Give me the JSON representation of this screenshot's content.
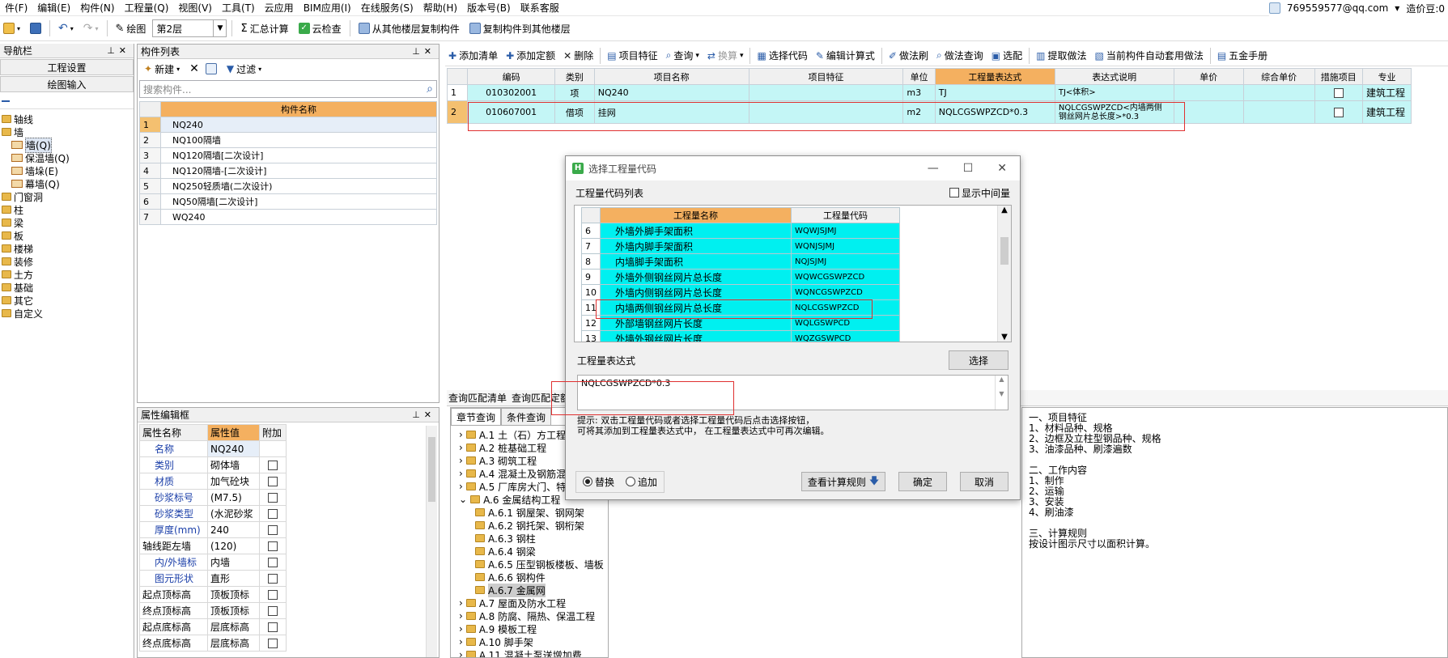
{
  "menubar": {
    "items": [
      "件(F)",
      "编辑(E)",
      "构件(N)",
      "工程量(Q)",
      "视图(V)",
      "工具(T)",
      "云应用",
      "BIM应用(I)",
      "在线服务(S)",
      "帮助(H)",
      "版本号(B)",
      "联系客服"
    ],
    "account": "769559577@qq.com",
    "account_suffix": "▾",
    "coins": "造价豆:0"
  },
  "toolbar1": {
    "draw_label": "绘图",
    "floor": "第2层",
    "sum_calc": "汇总计算",
    "cloud_check": "云检查",
    "copy_from_floor": "从其他楼层复制构件",
    "copy_to_floor": "复制构件到其他楼层"
  },
  "nav": {
    "title": "导航栏",
    "btn1": "工程设置",
    "btn2": "绘图输入",
    "tree": [
      {
        "label": "轴线",
        "indent": 0,
        "type": "folder"
      },
      {
        "label": "墙",
        "indent": 0,
        "type": "folder"
      },
      {
        "label": "墙(Q)",
        "indent": 1,
        "type": "wall"
      },
      {
        "label": "保温墙(Q)",
        "indent": 1,
        "type": "wall"
      },
      {
        "label": "墙垛(E)",
        "indent": 1,
        "type": "wall"
      },
      {
        "label": "幕墙(Q)",
        "indent": 1,
        "type": "wall"
      },
      {
        "label": "门窗洞",
        "indent": 0,
        "type": "folder"
      },
      {
        "label": "柱",
        "indent": 0,
        "type": "folder"
      },
      {
        "label": "梁",
        "indent": 0,
        "type": "folder"
      },
      {
        "label": "板",
        "indent": 0,
        "type": "folder"
      },
      {
        "label": "楼梯",
        "indent": 0,
        "type": "folder"
      },
      {
        "label": "装修",
        "indent": 0,
        "type": "folder"
      },
      {
        "label": "土方",
        "indent": 0,
        "type": "folder"
      },
      {
        "label": "基础",
        "indent": 0,
        "type": "folder"
      },
      {
        "label": "其它",
        "indent": 0,
        "type": "folder"
      },
      {
        "label": "自定义",
        "indent": 0,
        "type": "folder"
      }
    ]
  },
  "components": {
    "title": "构件列表",
    "new_label": "新建",
    "filter_label": "过滤",
    "search_placeholder": "搜索构件...",
    "col_header": "构件名称",
    "rows": [
      "NQ240",
      "NQ100隔墙",
      "NQ120隔墙[二次设计]",
      "NQ120隔墙-[二次设计]",
      "NQ250轻质墙(二次设计)",
      "NQ50隔墙[二次设计]",
      "WQ240"
    ]
  },
  "props": {
    "title": "属性编辑框",
    "headers": [
      "属性名称",
      "属性值",
      "附加"
    ],
    "rows": [
      {
        "name": "名称",
        "value": "NQ240",
        "blue": true
      },
      {
        "name": "类别",
        "value": "砌体墙",
        "blue": true
      },
      {
        "name": "材质",
        "value": "加气砼块",
        "blue": true
      },
      {
        "name": "砂浆标号",
        "value": "(M7.5)",
        "blue": true
      },
      {
        "name": "砂浆类型",
        "value": "(水泥砂浆",
        "blue": true
      },
      {
        "name": "厚度(mm)",
        "value": "240",
        "blue": true
      },
      {
        "name": "轴线距左墙",
        "value": "(120)",
        "blue": false
      },
      {
        "name": "内/外墙标",
        "value": "内墙",
        "blue": true
      },
      {
        "name": "图元形状",
        "value": "直形",
        "blue": true
      },
      {
        "name": "起点顶标高",
        "value": "顶板顶标",
        "blue": false
      },
      {
        "name": "终点顶标高",
        "value": "顶板顶标",
        "blue": false
      },
      {
        "name": "起点底标高",
        "value": "层底标高",
        "blue": false
      },
      {
        "name": "终点底标高",
        "value": "层底标高",
        "blue": false
      }
    ]
  },
  "maintoolbar": {
    "items": [
      "添加清单",
      "添加定额",
      "删除",
      "项目特征",
      "查询",
      "换算",
      "选择代码",
      "编辑计算式",
      "做法刷",
      "做法查询",
      "选配",
      "提取做法",
      "当前构件自动套用做法",
      "五金手册"
    ]
  },
  "maintable": {
    "headers": [
      "编码",
      "类别",
      "项目名称",
      "项目特征",
      "单位",
      "工程量表达式",
      "表达式说明",
      "单价",
      "综合单价",
      "措施项目",
      "专业"
    ],
    "rows": [
      {
        "num": "1",
        "code": "010302001",
        "type": "项",
        "name": "NQ240",
        "feature": "",
        "unit": "m3",
        "expr": "TJ",
        "desc": "TJ<体积>",
        "price": "",
        "cprice": "",
        "measure": "",
        "major": "建筑工程"
      },
      {
        "num": "2",
        "code": "010607001",
        "type": "借项",
        "name": "挂网",
        "feature": "",
        "unit": "m2",
        "expr": "NQLCGSWPZCD*0.3",
        "desc": "NQLCGSWPZCD<内墙两侧钢丝网片总长度>*0.3",
        "price": "",
        "cprice": "",
        "measure": "",
        "major": "建筑工程"
      }
    ]
  },
  "lower": {
    "tab1": "查询匹配清单",
    "tab2": "查询匹配定额",
    "subtab1": "章节查询",
    "subtab2": "条件查询",
    "tree": [
      {
        "label": "A.1 土（石）方工程",
        "level": 0
      },
      {
        "label": "A.2 桩基础工程",
        "level": 0
      },
      {
        "label": "A.3 砌筑工程",
        "level": 0
      },
      {
        "label": "A.4 混凝土及钢筋混凝土工程",
        "level": 0
      },
      {
        "label": "A.5 厂库房大门、特种门",
        "level": 0
      },
      {
        "label": "A.6 金属结构工程",
        "level": 0
      },
      {
        "label": "A.6.1 钢屋架、钢网架",
        "level": 1
      },
      {
        "label": "A.6.2 钢托架、钢桁架",
        "level": 1
      },
      {
        "label": "A.6.3 钢柱",
        "level": 1
      },
      {
        "label": "A.6.4 钢梁",
        "level": 1
      },
      {
        "label": "A.6.5 压型钢板楼板、墙板",
        "level": 1
      },
      {
        "label": "A.6.6 钢构件",
        "level": 1
      },
      {
        "label": "A.6.7 金属网",
        "level": 1
      },
      {
        "label": "A.7 屋面及防水工程",
        "level": 0
      },
      {
        "label": "A.8 防腐、隔热、保温工程",
        "level": 0
      },
      {
        "label": "A.9 模板工程",
        "level": 0
      },
      {
        "label": "A.10 脚手架",
        "level": 0
      },
      {
        "label": "A.11 混凝土泵送增加费",
        "level": 0
      }
    ],
    "desc_lines": [
      "一、项目特征",
      "1、材料品种、规格",
      "2、边框及立柱型钢品种、规格",
      "3、油漆品种、刷漆遍数",
      "",
      "二、工作内容",
      "1、制作",
      "2、运输",
      "3、安装",
      "4、刷油漆",
      "",
      "三、计算规则",
      " 按设计图示尺寸以面积计算。"
    ]
  },
  "dialog": {
    "title": "选择工程量代码",
    "list_label": "工程量代码列表",
    "show_middle": "显示中间量",
    "col_name": "工程量名称",
    "col_code": "工程量代码",
    "rows": [
      {
        "num": "6",
        "name": "外墙外脚手架面积",
        "code": "WQWJSJMJ"
      },
      {
        "num": "7",
        "name": "外墙内脚手架面积",
        "code": "WQNJSJMJ"
      },
      {
        "num": "8",
        "name": "内墙脚手架面积",
        "code": "NQJSJMJ"
      },
      {
        "num": "9",
        "name": "外墙外侧钢丝网片总长度",
        "code": "WQWCGSWPZCD"
      },
      {
        "num": "10",
        "name": "外墙内侧钢丝网片总长度",
        "code": "WQNCGSWPZCD"
      },
      {
        "num": "11",
        "name": "内墙两侧钢丝网片总长度",
        "code": "NQLCGSWPZCD"
      },
      {
        "num": "12",
        "name": "外部墙钢丝网片长度",
        "code": "WQLGSWPCD"
      },
      {
        "num": "13",
        "name": "外墙外钢丝网片长度",
        "code": "WQZGSWPCD"
      }
    ],
    "expr_label": "工程量表达式",
    "select_btn": "选择",
    "expr_value": "NQLCGSWPZCD*0.3",
    "hint_line1": "提示: 双击工程量代码或者选择工程量代码后点击选择按钮，",
    "hint_line2": "可将其添加到工程量表达式中，  在工程量表达式中可再次编辑。",
    "radio_replace": "替换",
    "radio_append": "追加",
    "calc_rule_btn": "查看计算规则",
    "ok_btn": "确定",
    "cancel_btn": "取消"
  }
}
